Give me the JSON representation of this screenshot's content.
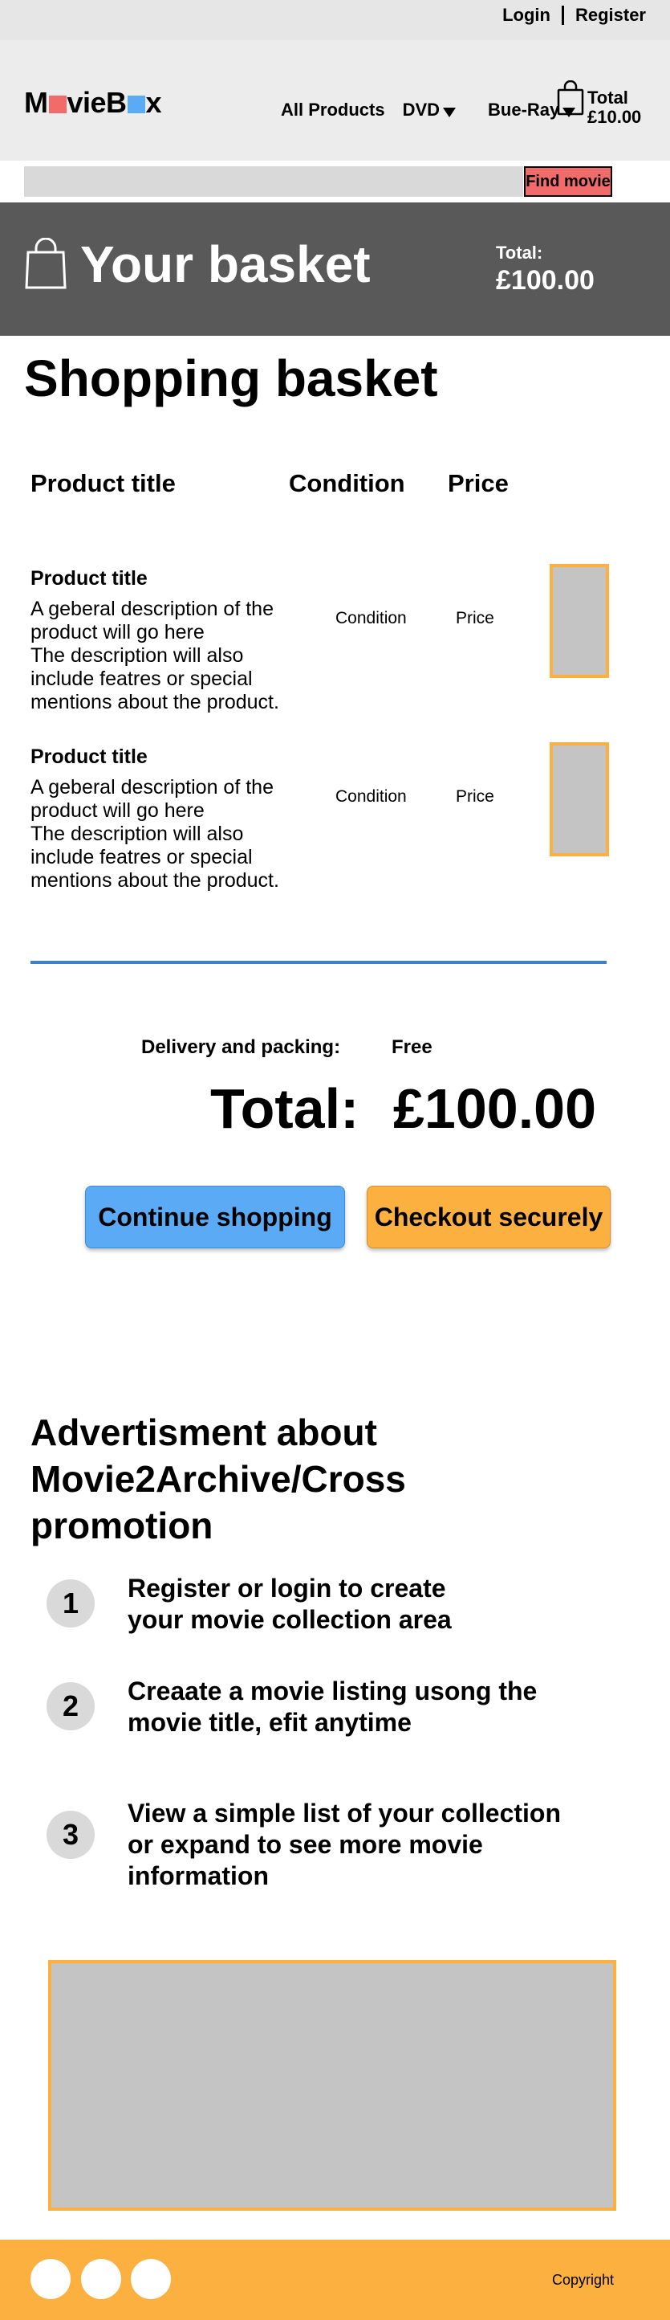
{
  "auth": {
    "login": "Login",
    "register": "Register"
  },
  "logo": {
    "part1": "M",
    "part2": "vieB",
    "part3": "x",
    "square1_color": "#f26b6b",
    "square2_color": "#5aaaf5"
  },
  "nav": {
    "items": [
      "All Products",
      "DVD",
      "Bue-Ray"
    ]
  },
  "cart": {
    "label_line1": "Total",
    "label_line2": "£10.00",
    "icon": "shopping-bag-icon"
  },
  "search": {
    "placeholder": "",
    "button": "Find movie"
  },
  "banner": {
    "title": "Your basket",
    "total_label": "Total:",
    "total_value": "£100.00",
    "icon": "shopping-bag-icon"
  },
  "page_title": "Shopping basket",
  "table": {
    "headers": [
      "Product title",
      "Condition",
      "Price"
    ],
    "rows": [
      {
        "title": "Product title",
        "description": [
          "A geberal description of the",
          "product will go here",
          "The description will also",
          "include featres or special",
          "mentions about the product."
        ],
        "condition": "Condition",
        "price": "Price"
      },
      {
        "title": "Product title",
        "description": [
          "A geberal description of the",
          "product will go here",
          "The description will also",
          "include featres or special",
          "mentions about the product."
        ],
        "condition": "Condition",
        "price": "Price"
      }
    ]
  },
  "summary": {
    "delivery_label": "Delivery and packing:",
    "delivery_value": "Free",
    "total_label": "Total:",
    "total_value": "£100.00"
  },
  "buttons": {
    "continue": "Continue shopping",
    "checkout": "Checkout securely"
  },
  "advert": {
    "title_lines": [
      "Advertisment about",
      "Movie2Archive/Cross",
      "promotion"
    ],
    "steps": [
      {
        "num": "1",
        "lines": [
          "Register or login to create",
          "your movie collection area"
        ]
      },
      {
        "num": "2",
        "lines": [
          "Creaate a movie listing usong the",
          "movie title, efit anytime"
        ]
      },
      {
        "num": "3",
        "lines": [
          "View a simple list of your collection",
          "or expand to see more movie",
          "information"
        ]
      }
    ]
  },
  "footer": {
    "copyright": "Copyright"
  },
  "colors": {
    "accent_orange": "#fbb040",
    "accent_blue": "#5aaaf5",
    "accent_red": "#f26b6b",
    "banner_grey": "#595959"
  }
}
